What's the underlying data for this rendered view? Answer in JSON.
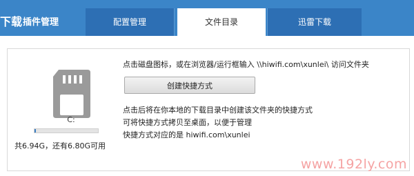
{
  "header": {
    "brand_main": "下载",
    "brand_sub": "插件管理",
    "tabs": [
      {
        "label": "配置管理",
        "active": false
      },
      {
        "label": "文件目录",
        "active": true
      },
      {
        "label": "迅雷下载",
        "active": false
      }
    ]
  },
  "disk": {
    "icon": "sd-card-icon",
    "letter": "C:",
    "usage_text": "共6.94G，还有6.80G可用",
    "used_fraction": 0.02
  },
  "content": {
    "instruction": "点击磁盘图标，或在浏览器/运行框输入 \\\\hiwifi.com\\xunlei\\ 访问文件夹",
    "create_shortcut_label": "创建快捷方式",
    "desc_lines": [
      "点击后将在你本地的下载目录中创建该文件夹的快捷方式",
      "可将快捷方式拷贝至桌面，以便于管理",
      "快捷方式对应的是 hiwifi.com\\xunlei"
    ]
  },
  "watermark": "www.192ly.com",
  "colors": {
    "header_bg": "#3b85c8",
    "tab_bg": "#2d6fb4",
    "usage_fill": "#3b7fc4"
  }
}
